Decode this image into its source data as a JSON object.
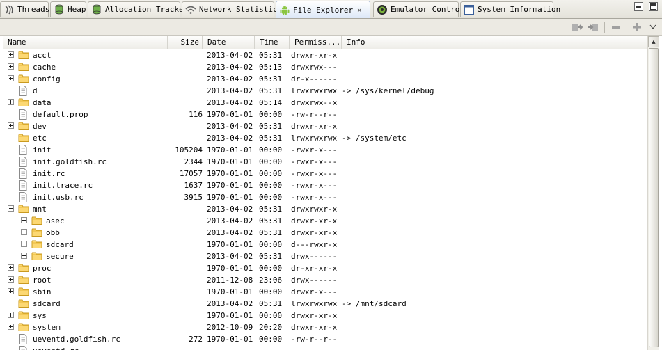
{
  "tabs": [
    {
      "label": "Threads",
      "icon": "threads-icon",
      "active": false
    },
    {
      "label": "Heap",
      "icon": "heap-icon",
      "active": false
    },
    {
      "label": "Allocation Tracker",
      "icon": "allocation-icon",
      "active": false
    },
    {
      "label": "Network Statistics",
      "icon": "network-icon",
      "active": false
    },
    {
      "label": "File Explorer",
      "icon": "android-icon",
      "active": true
    },
    {
      "label": "Emulator Control",
      "icon": "emulator-icon",
      "active": false
    },
    {
      "label": "System Information",
      "icon": "system-info-icon",
      "active": false
    }
  ],
  "toolbar": {
    "buttons": [
      "pull-file-icon",
      "push-file-icon",
      "delete-icon",
      "new-folder-icon"
    ]
  },
  "columns": {
    "name": "Name",
    "size": "Size",
    "date": "Date",
    "time": "Time",
    "perm": "Permiss...",
    "info": "Info"
  },
  "rows": [
    {
      "level": 0,
      "expander": "plus",
      "type": "folder",
      "name": "acct",
      "size": "",
      "date": "2013-04-02",
      "time": "05:31",
      "perm": "drwxr-xr-x",
      "info": ""
    },
    {
      "level": 0,
      "expander": "plus",
      "type": "folder",
      "name": "cache",
      "size": "",
      "date": "2013-04-02",
      "time": "05:13",
      "perm": "drwxrwx---",
      "info": ""
    },
    {
      "level": 0,
      "expander": "plus",
      "type": "folder",
      "name": "config",
      "size": "",
      "date": "2013-04-02",
      "time": "05:31",
      "perm": "dr-x------",
      "info": ""
    },
    {
      "level": 0,
      "expander": "",
      "type": "file",
      "name": "d",
      "size": "",
      "date": "2013-04-02",
      "time": "05:31",
      "perm": "lrwxrwxrwx",
      "info": "-> /sys/kernel/debug"
    },
    {
      "level": 0,
      "expander": "plus",
      "type": "folder",
      "name": "data",
      "size": "",
      "date": "2013-04-02",
      "time": "05:14",
      "perm": "drwxrwx--x",
      "info": ""
    },
    {
      "level": 0,
      "expander": "",
      "type": "file",
      "name": "default.prop",
      "size": "116",
      "date": "1970-01-01",
      "time": "00:00",
      "perm": "-rw-r--r--",
      "info": ""
    },
    {
      "level": 0,
      "expander": "plus",
      "type": "folder",
      "name": "dev",
      "size": "",
      "date": "2013-04-02",
      "time": "05:31",
      "perm": "drwxr-xr-x",
      "info": ""
    },
    {
      "level": 0,
      "expander": "",
      "type": "folder",
      "name": "etc",
      "size": "",
      "date": "2013-04-02",
      "time": "05:31",
      "perm": "lrwxrwxrwx",
      "info": "-> /system/etc"
    },
    {
      "level": 0,
      "expander": "",
      "type": "file",
      "name": "init",
      "size": "105204",
      "date": "1970-01-01",
      "time": "00:00",
      "perm": "-rwxr-x---",
      "info": ""
    },
    {
      "level": 0,
      "expander": "",
      "type": "file",
      "name": "init.goldfish.rc",
      "size": "2344",
      "date": "1970-01-01",
      "time": "00:00",
      "perm": "-rwxr-x---",
      "info": ""
    },
    {
      "level": 0,
      "expander": "",
      "type": "file",
      "name": "init.rc",
      "size": "17057",
      "date": "1970-01-01",
      "time": "00:00",
      "perm": "-rwxr-x---",
      "info": ""
    },
    {
      "level": 0,
      "expander": "",
      "type": "file",
      "name": "init.trace.rc",
      "size": "1637",
      "date": "1970-01-01",
      "time": "00:00",
      "perm": "-rwxr-x---",
      "info": ""
    },
    {
      "level": 0,
      "expander": "",
      "type": "file",
      "name": "init.usb.rc",
      "size": "3915",
      "date": "1970-01-01",
      "time": "00:00",
      "perm": "-rwxr-x---",
      "info": ""
    },
    {
      "level": 0,
      "expander": "minus",
      "type": "folder",
      "name": "mnt",
      "size": "",
      "date": "2013-04-02",
      "time": "05:31",
      "perm": "drwxrwxr-x",
      "info": ""
    },
    {
      "level": 1,
      "expander": "plus",
      "type": "folder",
      "name": "asec",
      "size": "",
      "date": "2013-04-02",
      "time": "05:31",
      "perm": "drwxr-xr-x",
      "info": ""
    },
    {
      "level": 1,
      "expander": "plus",
      "type": "folder",
      "name": "obb",
      "size": "",
      "date": "2013-04-02",
      "time": "05:31",
      "perm": "drwxr-xr-x",
      "info": ""
    },
    {
      "level": 1,
      "expander": "plus",
      "type": "folder",
      "name": "sdcard",
      "size": "",
      "date": "1970-01-01",
      "time": "00:00",
      "perm": "d---rwxr-x",
      "info": ""
    },
    {
      "level": 1,
      "expander": "plus",
      "type": "folder",
      "name": "secure",
      "size": "",
      "date": "2013-04-02",
      "time": "05:31",
      "perm": "drwx------",
      "info": ""
    },
    {
      "level": 0,
      "expander": "plus",
      "type": "folder",
      "name": "proc",
      "size": "",
      "date": "1970-01-01",
      "time": "00:00",
      "perm": "dr-xr-xr-x",
      "info": ""
    },
    {
      "level": 0,
      "expander": "plus",
      "type": "folder",
      "name": "root",
      "size": "",
      "date": "2011-12-08",
      "time": "23:06",
      "perm": "drwx------",
      "info": ""
    },
    {
      "level": 0,
      "expander": "plus",
      "type": "folder",
      "name": "sbin",
      "size": "",
      "date": "1970-01-01",
      "time": "00:00",
      "perm": "drwxr-x---",
      "info": ""
    },
    {
      "level": 0,
      "expander": "",
      "type": "folder",
      "name": "sdcard",
      "size": "",
      "date": "2013-04-02",
      "time": "05:31",
      "perm": "lrwxrwxrwx",
      "info": "-> /mnt/sdcard"
    },
    {
      "level": 0,
      "expander": "plus",
      "type": "folder",
      "name": "sys",
      "size": "",
      "date": "1970-01-01",
      "time": "00:00",
      "perm": "drwxr-xr-x",
      "info": ""
    },
    {
      "level": 0,
      "expander": "plus",
      "type": "folder",
      "name": "system",
      "size": "",
      "date": "2012-10-09",
      "time": "20:20",
      "perm": "drwxr-xr-x",
      "info": ""
    },
    {
      "level": 0,
      "expander": "",
      "type": "file",
      "name": "ueventd.goldfish.rc",
      "size": "272",
      "date": "1970-01-01",
      "time": "00:00",
      "perm": "-rw-r--r--",
      "info": ""
    },
    {
      "level": 0,
      "expander": "",
      "type": "file",
      "name": "ueventd.rc",
      "size": "",
      "date": "",
      "time": "",
      "perm": "",
      "info": ""
    }
  ],
  "colors": {
    "folder": "#f4c64a",
    "folder_edge": "#c99a20",
    "active_tab": "#dde8f7"
  }
}
